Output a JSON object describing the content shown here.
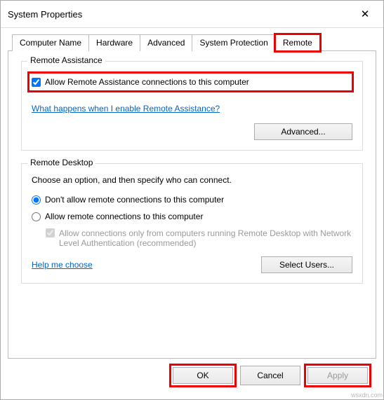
{
  "window": {
    "title": "System Properties",
    "close_label": "✕"
  },
  "tabs": {
    "items": [
      {
        "label": "Computer Name"
      },
      {
        "label": "Hardware"
      },
      {
        "label": "Advanced"
      },
      {
        "label": "System Protection"
      },
      {
        "label": "Remote"
      }
    ]
  },
  "remote_assistance": {
    "group_title": "Remote Assistance",
    "checkbox_label": "Allow Remote Assistance connections to this computer",
    "checkbox_checked": true,
    "help_link": "What happens when I enable Remote Assistance?",
    "advanced_button": "Advanced..."
  },
  "remote_desktop": {
    "group_title": "Remote Desktop",
    "instruction": "Choose an option, and then specify who can connect.",
    "radio1_label": "Don't allow remote connections to this computer",
    "radio2_label": "Allow remote connections to this computer",
    "nested_checkbox_label": "Allow connections only from computers running Remote Desktop with Network Level Authentication (recommended)",
    "help_link": "Help me choose",
    "select_users_button": "Select Users..."
  },
  "buttons": {
    "ok": "OK",
    "cancel": "Cancel",
    "apply": "Apply"
  },
  "watermark": "wsxdn.com"
}
